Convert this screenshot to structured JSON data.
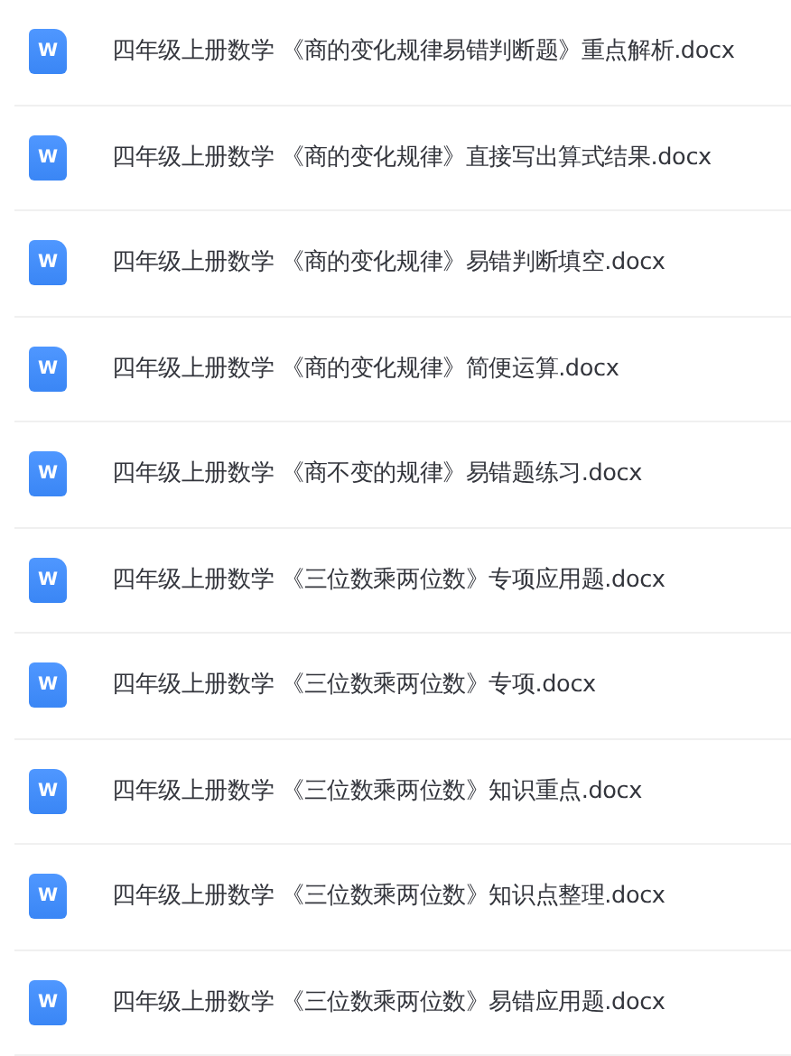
{
  "files": [
    {
      "icon_letter": "W",
      "name": "四年级上册数学 《商的变化规律易错判断题》重点解析.docx"
    },
    {
      "icon_letter": "W",
      "name": "四年级上册数学 《商的变化规律》直接写出算式结果.docx"
    },
    {
      "icon_letter": "W",
      "name": "四年级上册数学 《商的变化规律》易错判断填空.docx"
    },
    {
      "icon_letter": "W",
      "name": "四年级上册数学 《商的变化规律》简便运算.docx"
    },
    {
      "icon_letter": "W",
      "name": "四年级上册数学 《商不变的规律》易错题练习.docx"
    },
    {
      "icon_letter": "W",
      "name": "四年级上册数学 《三位数乘两位数》专项应用题.docx"
    },
    {
      "icon_letter": "W",
      "name": "四年级上册数学 《三位数乘两位数》专项.docx"
    },
    {
      "icon_letter": "W",
      "name": "四年级上册数学 《三位数乘两位数》知识重点.docx"
    },
    {
      "icon_letter": "W",
      "name": "四年级上册数学 《三位数乘两位数》知识点整理.docx"
    },
    {
      "icon_letter": "W",
      "name": "四年级上册数学 《三位数乘两位数》易错应用题.docx"
    }
  ]
}
